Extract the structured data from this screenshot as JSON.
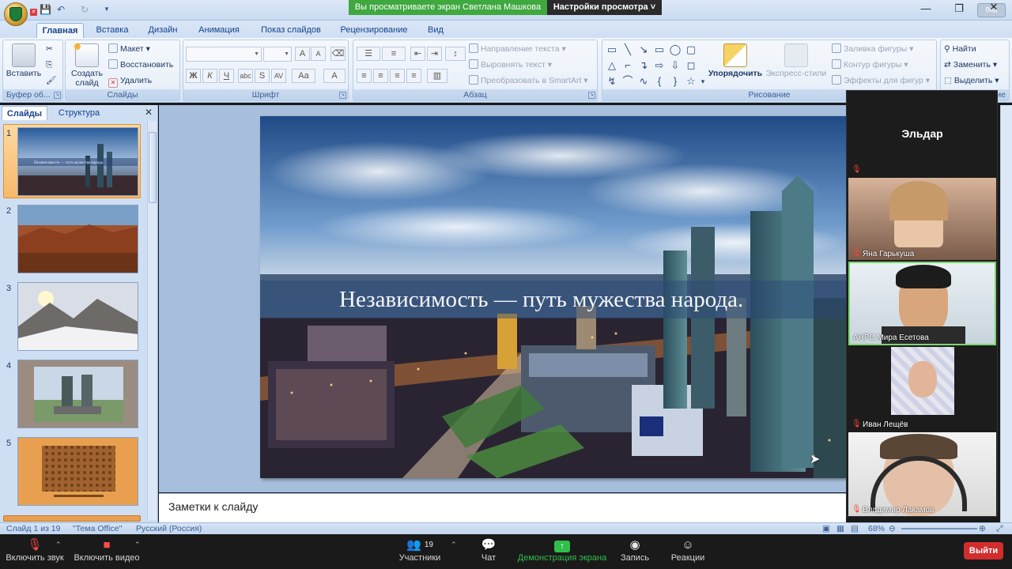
{
  "sharing": {
    "banner": "Вы просматриваете экран Светлана Машкова",
    "view_settings": "Настройки просмотра ˅"
  },
  "window": {
    "minimize": "—",
    "restore": "❐",
    "close": "✕",
    "zoom_badge": "Вид"
  },
  "ribbon": {
    "tabs": [
      "Главная",
      "Вставка",
      "Дизайн",
      "Анимация",
      "Показ слайдов",
      "Рецензирование",
      "Вид"
    ],
    "active_tab": "Главная",
    "groups": {
      "clipboard": {
        "label": "Буфер об...",
        "paste": "Вставить"
      },
      "slides": {
        "label": "Слайды",
        "new_slide": "Создать слайд",
        "layout": "Макет",
        "reset": "Восстановить",
        "delete": "Удалить"
      },
      "font": {
        "label": "Шрифт"
      },
      "paragraph": {
        "label": "Абзац",
        "text_direction": "Направление текста",
        "align_text": "Выровнять текст",
        "smartart": "Преобразовать в SmartArt"
      },
      "drawing": {
        "label": "Рисование",
        "arrange": "Упорядочить",
        "quick_styles": "Экспресс-стили",
        "shape_fill": "Заливка фигуры",
        "shape_outline": "Контур фигуры",
        "shape_effects": "Эффекты для фигур"
      },
      "editing": {
        "label": "ние",
        "find": "Найти",
        "replace": "Заменить",
        "select": "Выделить"
      }
    }
  },
  "slides_panel": {
    "tabs": [
      "Слайды",
      "Структура"
    ],
    "active_tab": "Слайды",
    "thumbnails": [
      {
        "number": "1",
        "caption": "Независимость — путь мужества народа."
      },
      {
        "number": "2",
        "caption": ""
      },
      {
        "number": "3",
        "caption": ""
      },
      {
        "number": "4",
        "caption": ""
      },
      {
        "number": "5",
        "caption": ""
      }
    ]
  },
  "slide": {
    "title": "Независимость — путь мужества народа."
  },
  "notes": {
    "placeholder": "Заметки к слайду"
  },
  "status": {
    "slide_counter": "Слайд 1 из 19",
    "theme": "\"Тема Office\"",
    "language": "Русский (Россия)",
    "zoom": "68%"
  },
  "participants": [
    {
      "name": "Эльдар",
      "video": false
    },
    {
      "name": "Яна Гарькуша",
      "video": true
    },
    {
      "name": "АНРС Мира Есетова",
      "video": true
    },
    {
      "name": "Иван Лещёв",
      "video": true
    },
    {
      "name": "Владимир Лакамов",
      "video": true
    }
  ],
  "meeting_bar": {
    "unmute": "Включить звук",
    "start_video": "Включить видео",
    "participants": "Участники",
    "participants_count": "19",
    "chat": "Чат",
    "share_screen": "Демонстрация экрана",
    "record": "Запись",
    "reactions": "Реакции",
    "leave": "Выйти"
  },
  "colors": {
    "share_banner": "#3fa83f",
    "leave_button": "#d22d2d",
    "share_icon": "#2fbf4a",
    "ribbon_text": "#15428b"
  }
}
